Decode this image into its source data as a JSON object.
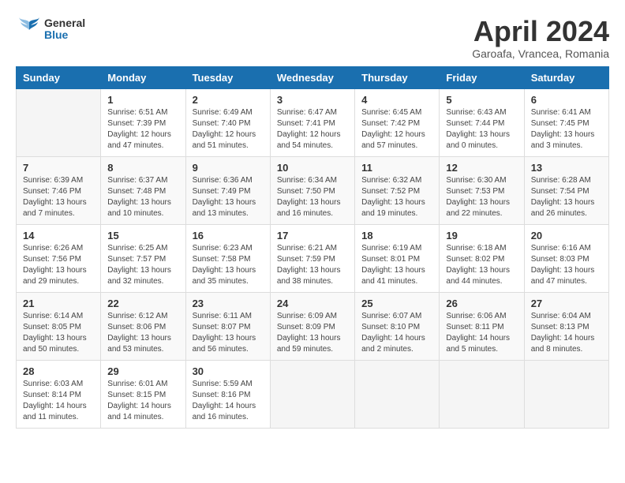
{
  "title": "April 2024",
  "subtitle": "Garoafa, Vrancea, Romania",
  "logo": {
    "line1": "General",
    "line2": "Blue"
  },
  "headers": [
    "Sunday",
    "Monday",
    "Tuesday",
    "Wednesday",
    "Thursday",
    "Friday",
    "Saturday"
  ],
  "weeks": [
    [
      {
        "day": "",
        "info": ""
      },
      {
        "day": "1",
        "info": "Sunrise: 6:51 AM\nSunset: 7:39 PM\nDaylight: 12 hours\nand 47 minutes."
      },
      {
        "day": "2",
        "info": "Sunrise: 6:49 AM\nSunset: 7:40 PM\nDaylight: 12 hours\nand 51 minutes."
      },
      {
        "day": "3",
        "info": "Sunrise: 6:47 AM\nSunset: 7:41 PM\nDaylight: 12 hours\nand 54 minutes."
      },
      {
        "day": "4",
        "info": "Sunrise: 6:45 AM\nSunset: 7:42 PM\nDaylight: 12 hours\nand 57 minutes."
      },
      {
        "day": "5",
        "info": "Sunrise: 6:43 AM\nSunset: 7:44 PM\nDaylight: 13 hours\nand 0 minutes."
      },
      {
        "day": "6",
        "info": "Sunrise: 6:41 AM\nSunset: 7:45 PM\nDaylight: 13 hours\nand 3 minutes."
      }
    ],
    [
      {
        "day": "7",
        "info": "Sunrise: 6:39 AM\nSunset: 7:46 PM\nDaylight: 13 hours\nand 7 minutes."
      },
      {
        "day": "8",
        "info": "Sunrise: 6:37 AM\nSunset: 7:48 PM\nDaylight: 13 hours\nand 10 minutes."
      },
      {
        "day": "9",
        "info": "Sunrise: 6:36 AM\nSunset: 7:49 PM\nDaylight: 13 hours\nand 13 minutes."
      },
      {
        "day": "10",
        "info": "Sunrise: 6:34 AM\nSunset: 7:50 PM\nDaylight: 13 hours\nand 16 minutes."
      },
      {
        "day": "11",
        "info": "Sunrise: 6:32 AM\nSunset: 7:52 PM\nDaylight: 13 hours\nand 19 minutes."
      },
      {
        "day": "12",
        "info": "Sunrise: 6:30 AM\nSunset: 7:53 PM\nDaylight: 13 hours\nand 22 minutes."
      },
      {
        "day": "13",
        "info": "Sunrise: 6:28 AM\nSunset: 7:54 PM\nDaylight: 13 hours\nand 26 minutes."
      }
    ],
    [
      {
        "day": "14",
        "info": "Sunrise: 6:26 AM\nSunset: 7:56 PM\nDaylight: 13 hours\nand 29 minutes."
      },
      {
        "day": "15",
        "info": "Sunrise: 6:25 AM\nSunset: 7:57 PM\nDaylight: 13 hours\nand 32 minutes."
      },
      {
        "day": "16",
        "info": "Sunrise: 6:23 AM\nSunset: 7:58 PM\nDaylight: 13 hours\nand 35 minutes."
      },
      {
        "day": "17",
        "info": "Sunrise: 6:21 AM\nSunset: 7:59 PM\nDaylight: 13 hours\nand 38 minutes."
      },
      {
        "day": "18",
        "info": "Sunrise: 6:19 AM\nSunset: 8:01 PM\nDaylight: 13 hours\nand 41 minutes."
      },
      {
        "day": "19",
        "info": "Sunrise: 6:18 AM\nSunset: 8:02 PM\nDaylight: 13 hours\nand 44 minutes."
      },
      {
        "day": "20",
        "info": "Sunrise: 6:16 AM\nSunset: 8:03 PM\nDaylight: 13 hours\nand 47 minutes."
      }
    ],
    [
      {
        "day": "21",
        "info": "Sunrise: 6:14 AM\nSunset: 8:05 PM\nDaylight: 13 hours\nand 50 minutes."
      },
      {
        "day": "22",
        "info": "Sunrise: 6:12 AM\nSunset: 8:06 PM\nDaylight: 13 hours\nand 53 minutes."
      },
      {
        "day": "23",
        "info": "Sunrise: 6:11 AM\nSunset: 8:07 PM\nDaylight: 13 hours\nand 56 minutes."
      },
      {
        "day": "24",
        "info": "Sunrise: 6:09 AM\nSunset: 8:09 PM\nDaylight: 13 hours\nand 59 minutes."
      },
      {
        "day": "25",
        "info": "Sunrise: 6:07 AM\nSunset: 8:10 PM\nDaylight: 14 hours\nand 2 minutes."
      },
      {
        "day": "26",
        "info": "Sunrise: 6:06 AM\nSunset: 8:11 PM\nDaylight: 14 hours\nand 5 minutes."
      },
      {
        "day": "27",
        "info": "Sunrise: 6:04 AM\nSunset: 8:13 PM\nDaylight: 14 hours\nand 8 minutes."
      }
    ],
    [
      {
        "day": "28",
        "info": "Sunrise: 6:03 AM\nSunset: 8:14 PM\nDaylight: 14 hours\nand 11 minutes."
      },
      {
        "day": "29",
        "info": "Sunrise: 6:01 AM\nSunset: 8:15 PM\nDaylight: 14 hours\nand 14 minutes."
      },
      {
        "day": "30",
        "info": "Sunrise: 5:59 AM\nSunset: 8:16 PM\nDaylight: 14 hours\nand 16 minutes."
      },
      {
        "day": "",
        "info": ""
      },
      {
        "day": "",
        "info": ""
      },
      {
        "day": "",
        "info": ""
      },
      {
        "day": "",
        "info": ""
      }
    ]
  ]
}
